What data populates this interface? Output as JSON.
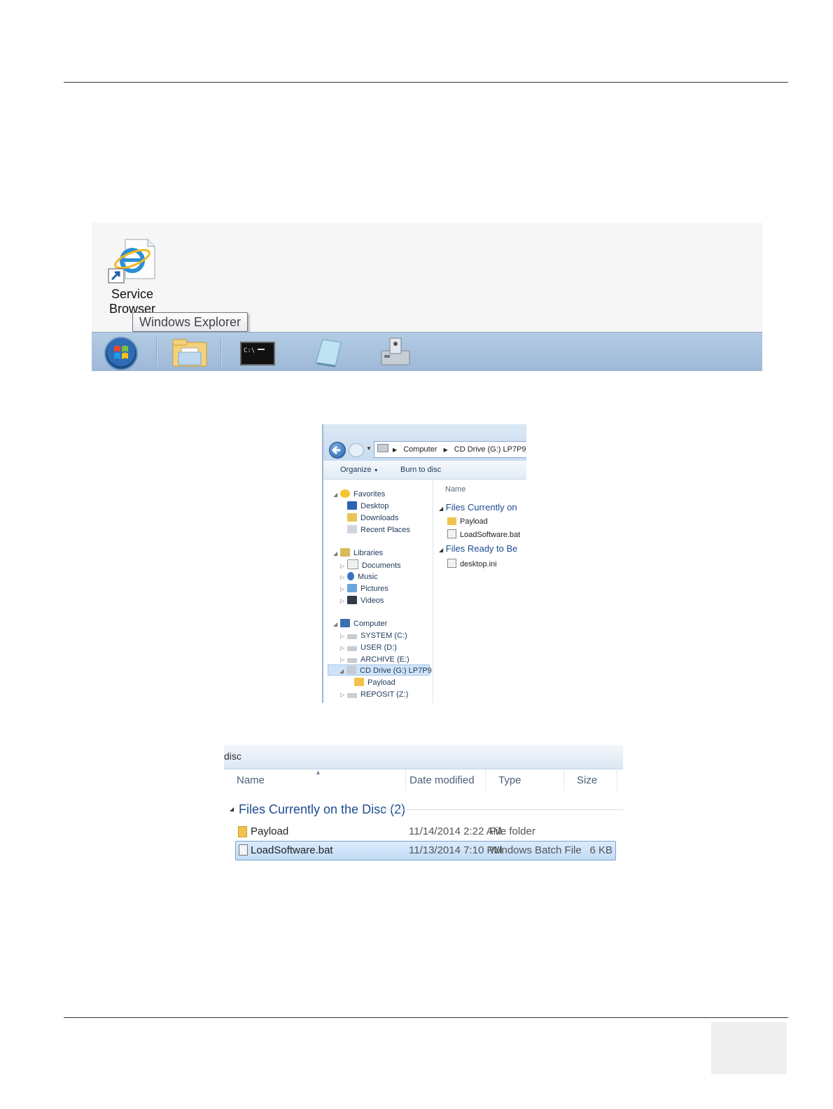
{
  "desktop": {
    "shortcut_label": "Service Browser",
    "tooltip": "Windows Explorer",
    "taskbar_items": [
      "start-orb-icon",
      "windows-explorer-icon",
      "command-prompt-icon",
      "notepad-icon",
      "service-tool-icon"
    ],
    "command_prompt_glyph": "C:\\_"
  },
  "explorer": {
    "address": {
      "part1": "Computer",
      "part2": "CD Drive (G:) LP7P9_"
    },
    "toolbar": {
      "organize": "Organize",
      "burn": "Burn to disc"
    },
    "nav": {
      "favorites": "Favorites",
      "desktop": "Desktop",
      "downloads": "Downloads",
      "recent": "Recent Places",
      "libraries": "Libraries",
      "documents": "Documents",
      "music": "Music",
      "pictures": "Pictures",
      "videos": "Videos",
      "computer": "Computer",
      "system": "SYSTEM (C:)",
      "user": "USER (D:)",
      "archive": "ARCHIVE (E:)",
      "cd": "CD Drive (G:) LP7P9",
      "payload": "Payload",
      "reposit": "REPOSIT (Z:)"
    },
    "content": {
      "name_header": "Name",
      "group1": "Files Currently on",
      "item1": "Payload",
      "item2": "LoadSoftware.bat",
      "group2": "Files Ready to Be",
      "item3": "desktop.ini"
    }
  },
  "detail": {
    "toolbar_fragment": "disc",
    "headers": {
      "name": "Name",
      "date": "Date modified",
      "type": "Type",
      "size": "Size"
    },
    "group": "Files Currently on the Disc (2)",
    "rows": [
      {
        "name": "Payload",
        "date": "11/14/2014 2:22 AM",
        "type": "File folder",
        "size": ""
      },
      {
        "name": "LoadSoftware.bat",
        "date": "11/13/2014 7:10 PM",
        "type": "Windows Batch File",
        "size": "6 KB"
      }
    ]
  }
}
